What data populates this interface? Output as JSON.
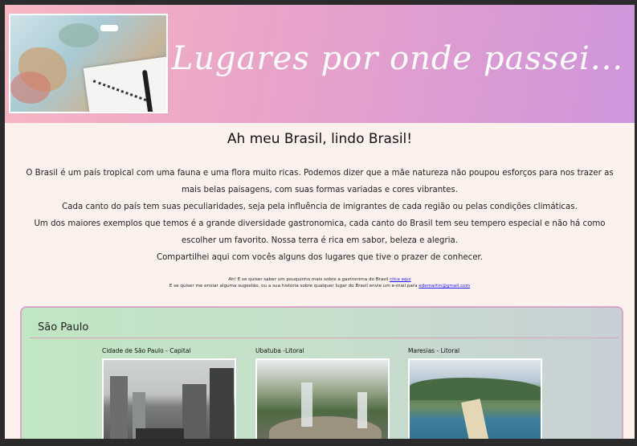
{
  "header": {
    "site_title": "Lugares por onde passei...",
    "photo_icon": "map-photo"
  },
  "main": {
    "title": "Ah meu Brasil, lindo Brasil!",
    "paragraphs": [
      "O Brasil é um país tropical com uma fauna e uma flora muito ricas. Podemos dizer que a mãe natureza não poupou esforços para nos trazer as mais belas paisagens, com suas formas variadas e cores vibrantes.",
      "Cada canto do país tem suas peculiaridades, seja pela influência de imigrantes de cada região ou pelas condições climáticas.",
      "Um dos maiores exemplos que temos é a grande diversidade gastronomica, cada canto do Brasil tem seu tempero especial e não há como escolher um favorito. Nossa terra é rica em sabor, beleza e alegria.",
      "Compartilhei aqui com vocês alguns dos lugares que tive o prazer de conhecer."
    ],
    "note_line1_text": "Ah! E se quiser saber um pouquinho mais sobre a gastronima do Brasil ",
    "note_line1_link": "clica aqui",
    "note_line2_text": "E se quiser me enviar alguma sugestão, ou a sua historia sobre qualquer lugar do Brasil envie um e-mail para ",
    "note_line2_link": "edemartin@gmail.com"
  },
  "section": {
    "title": "São Paulo",
    "cards": [
      {
        "title": "Cidade de São Paulo - Capital"
      },
      {
        "title": "Ubatuba -Litoral"
      },
      {
        "title": "Maresias - Litoral"
      }
    ]
  }
}
